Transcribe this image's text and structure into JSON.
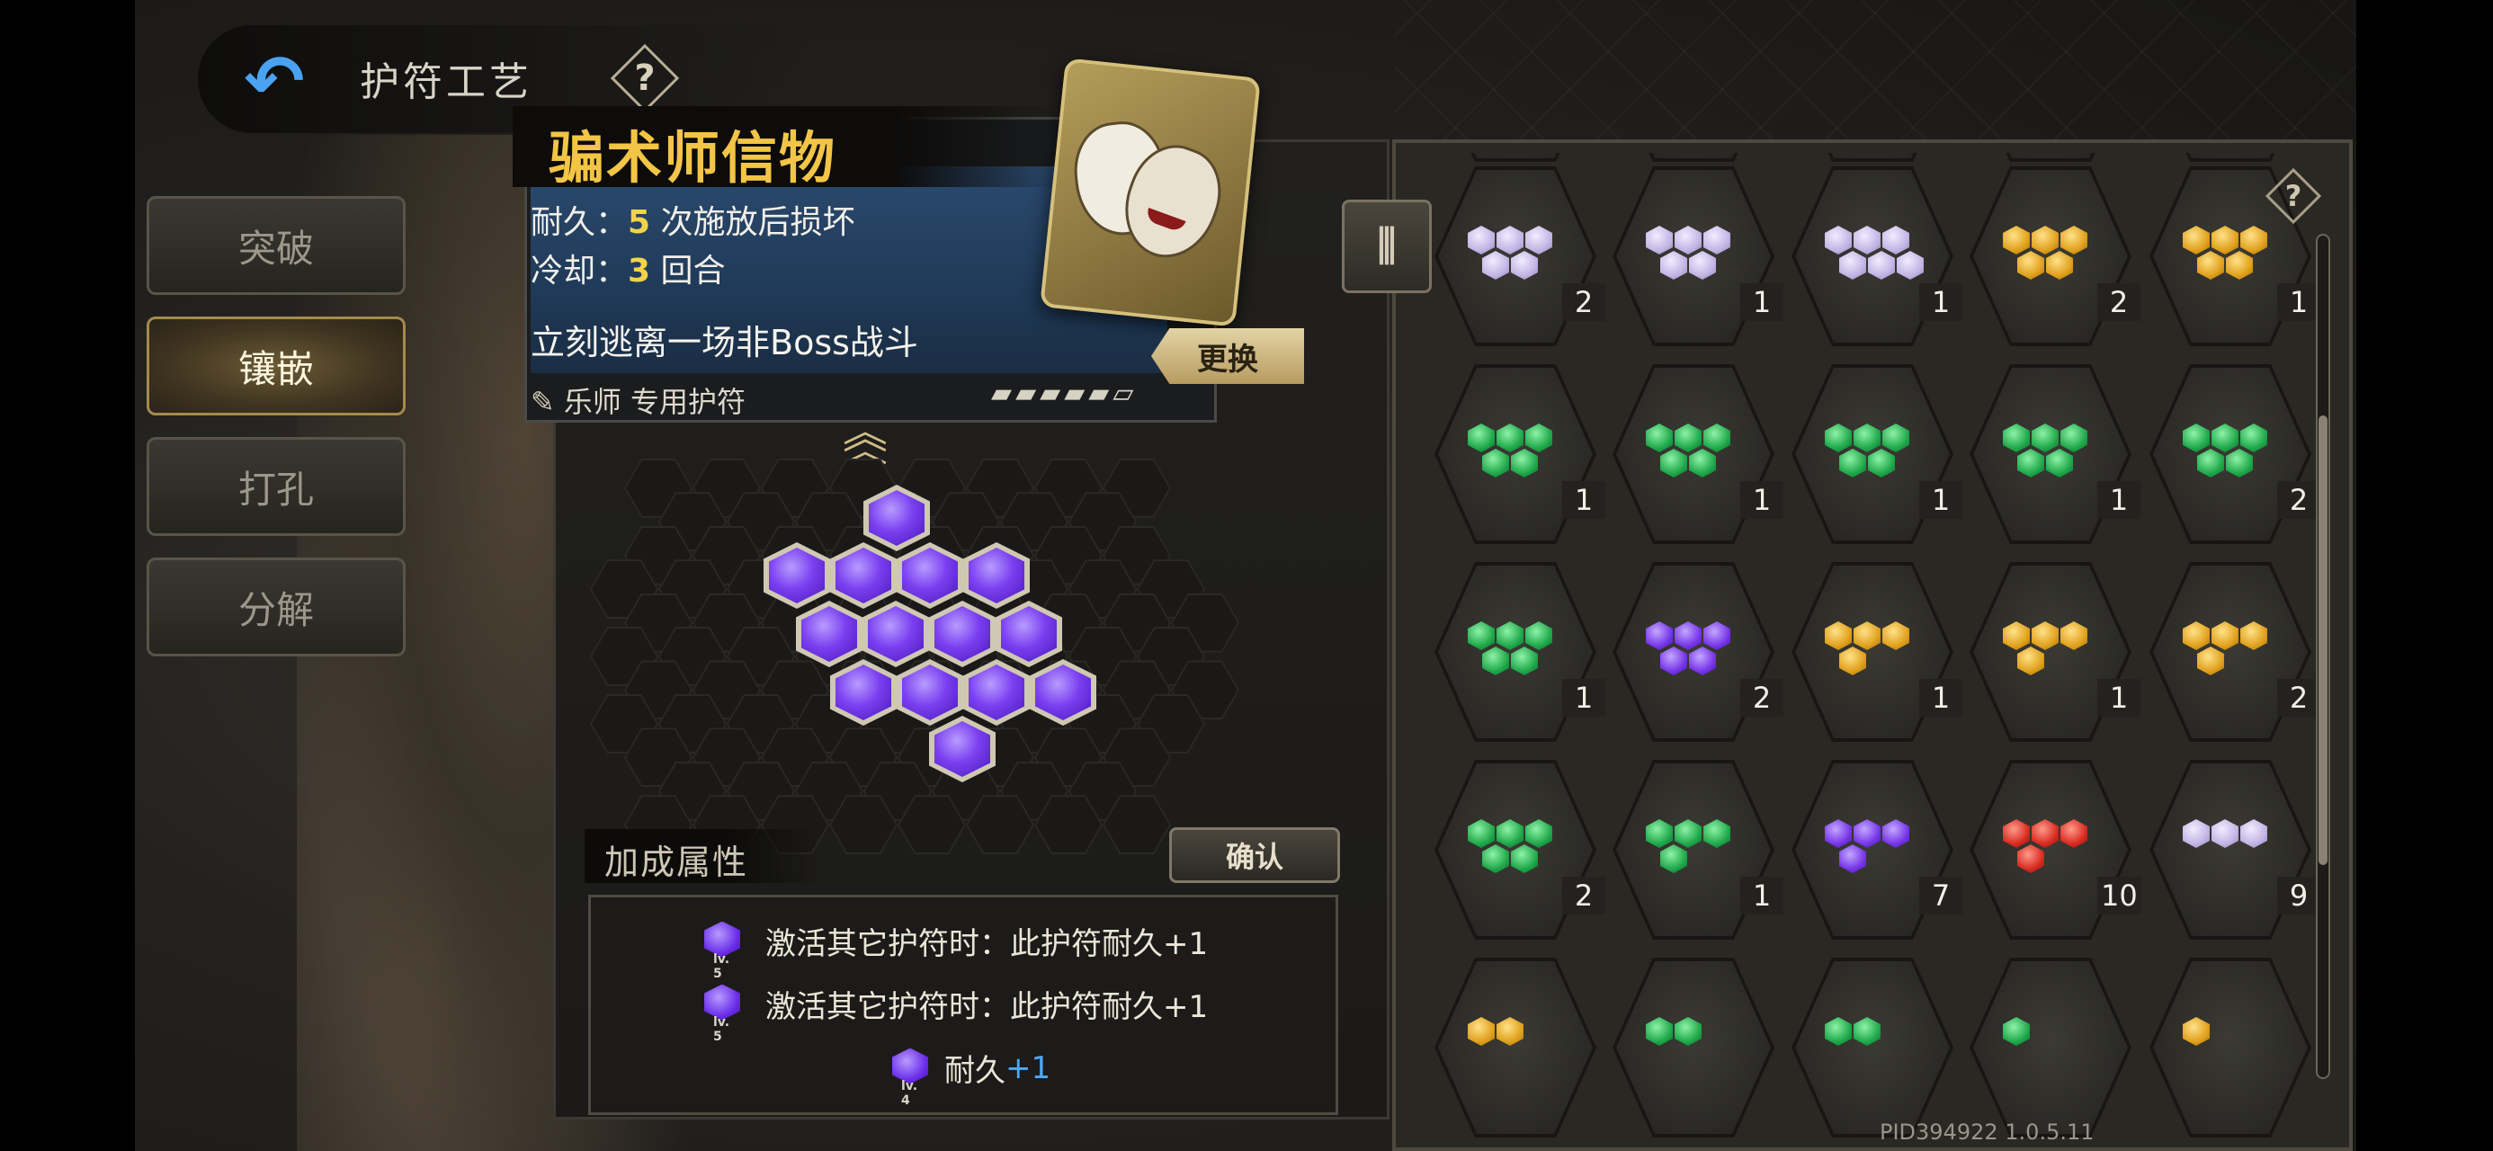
{
  "header": {
    "title": "护符工艺",
    "back_icon": "back-arrow-icon",
    "help_label": "?"
  },
  "tabs": [
    {
      "label": "突破",
      "active": false
    },
    {
      "label": "镶嵌",
      "active": true
    },
    {
      "label": "打孔",
      "active": false
    },
    {
      "label": "分解",
      "active": false
    }
  ],
  "item": {
    "name": "骗术师信物",
    "durability_label": "耐久：",
    "durability_value": "5",
    "durability_suffix": " 次施放后损坏",
    "cooldown_label": "冷却：",
    "cooldown_value": "3",
    "cooldown_suffix": " 回合",
    "effect": "立刻逃离一场非Boss战斗",
    "class_restriction": "乐师 专用护符",
    "durability_pips": "▰▰▰▰▰▱",
    "replace_label": "更换"
  },
  "bonus": {
    "title": "加成属性",
    "confirm_label": "确认",
    "rows": [
      {
        "level": "lv. 5",
        "text": "激活其它护符时：此护符耐久+1"
      },
      {
        "level": "lv. 5",
        "text": "激活其它护符时：此护符耐久+1"
      },
      {
        "level": "lv. 4",
        "text": "耐久",
        "plus": "+1"
      }
    ]
  },
  "inventory": {
    "filter_icon": "filter-icon",
    "help_label": "?",
    "counts": [
      [
        "1",
        "1",
        "1",
        "1",
        "2"
      ],
      [
        "2",
        "1",
        "1",
        "2",
        "1"
      ],
      [
        "1",
        "1",
        "1",
        "1",
        "2"
      ],
      [
        "1",
        "2",
        "1",
        "1",
        "2"
      ],
      [
        "2",
        "1",
        "7",
        "10",
        "9"
      ]
    ]
  },
  "colors": {
    "gem_purple": "#7a3ff0",
    "gem_lilac": "#c2b4e4",
    "gem_green": "#1fa84a",
    "gem_yellow": "#e0a01c",
    "gem_red": "#d82a20",
    "title_gold": "#f3c546",
    "accent_blue": "#4fa8f2"
  },
  "version": "PID394922  1.0.5.11"
}
